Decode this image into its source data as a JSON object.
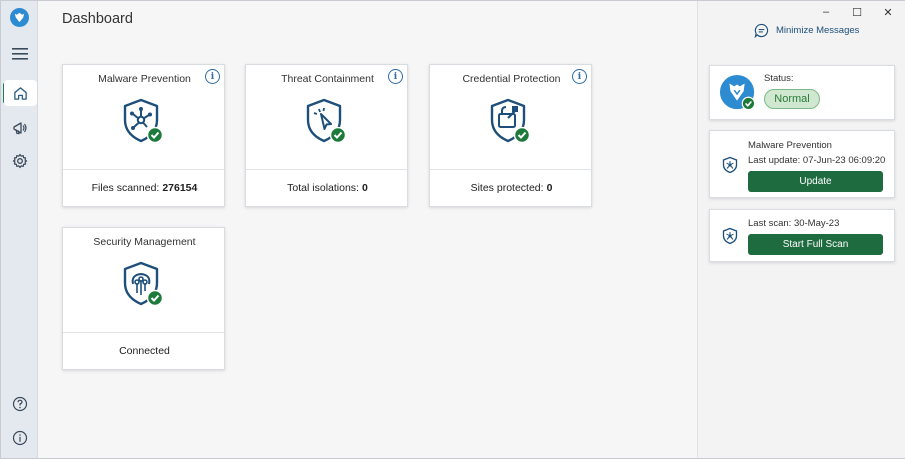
{
  "window": {
    "controls": {
      "minimize": "–",
      "maximize": "☐",
      "close": "✕"
    }
  },
  "sidebar": {
    "items": [
      {
        "name": "menu",
        "icon": "hamburger-icon"
      },
      {
        "name": "home",
        "icon": "home-icon",
        "active": true
      },
      {
        "name": "notifications",
        "icon": "megaphone-icon"
      },
      {
        "name": "settings",
        "icon": "gear-icon"
      },
      {
        "name": "help",
        "icon": "help-icon"
      },
      {
        "name": "about",
        "icon": "info-icon"
      }
    ],
    "accent_color": "#1f7d53"
  },
  "main": {
    "title": "Dashboard",
    "cards": [
      {
        "title": "Malware Prevention",
        "footer_label": "Files scanned:",
        "footer_value": "276154",
        "icon": "malware-shield-icon"
      },
      {
        "title": "Threat Containment",
        "footer_label": "Total isolations:",
        "footer_value": "0",
        "icon": "containment-shield-icon"
      },
      {
        "title": "Credential Protection",
        "footer_label": "Sites protected:",
        "footer_value": "0",
        "icon": "credential-shield-icon"
      },
      {
        "title": "Security Management",
        "footer_label": "Connected",
        "footer_value": "",
        "icon": "management-shield-icon"
      }
    ]
  },
  "right_panel": {
    "minimize_messages": "Minimize Messages",
    "status": {
      "label": "Status:",
      "value": "Normal",
      "color": "#2b7a3b"
    },
    "update": {
      "title": "Malware Prevention",
      "last_update": "Last update:  07-Jun-23 06:09:20",
      "button": "Update"
    },
    "scan": {
      "last_scan": "Last scan:  30-May-23",
      "button": "Start Full Scan"
    },
    "button_color": "#1e6b3f"
  }
}
